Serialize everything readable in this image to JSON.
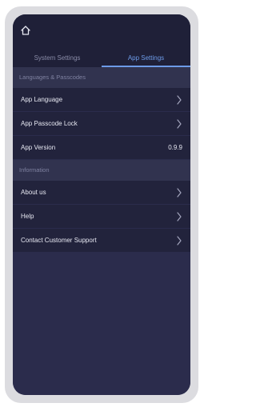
{
  "tabs": {
    "system": "System Settings",
    "app": "App Settings"
  },
  "sections": {
    "languages": {
      "title": "Languages & Passcodes",
      "rows": [
        {
          "label": "App Language"
        },
        {
          "label": "App Passcode Lock"
        },
        {
          "label": "App Version",
          "value": "0.9.9"
        }
      ]
    },
    "information": {
      "title": "Information",
      "rows": [
        {
          "label": "About us"
        },
        {
          "label": "Help"
        },
        {
          "label": "Contact Customer Support"
        }
      ]
    }
  },
  "icons": {
    "home": "home-icon",
    "chevron": "chevron-right-icon"
  },
  "colors": {
    "accent": "#6d9be8",
    "background": "#2b2c4c"
  }
}
